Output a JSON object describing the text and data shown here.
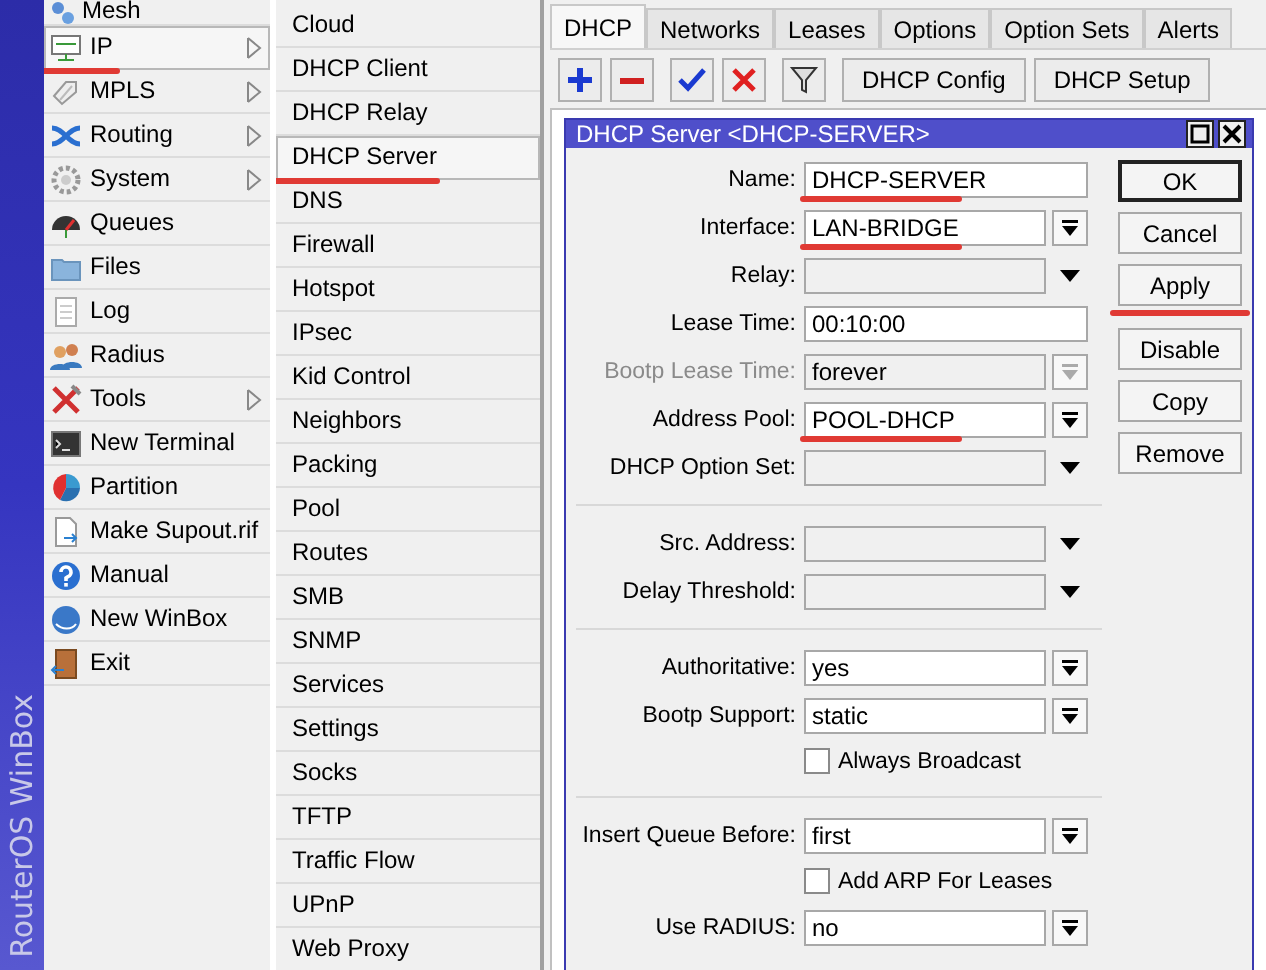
{
  "sidebar": {
    "brand": "RouterOS WinBox",
    "items": [
      {
        "label": "Mesh",
        "selected": false,
        "submenu": false,
        "underlined": false
      },
      {
        "label": "IP",
        "selected": true,
        "submenu": true,
        "underlined": true
      },
      {
        "label": "MPLS",
        "selected": false,
        "submenu": true,
        "underlined": false
      },
      {
        "label": "Routing",
        "selected": false,
        "submenu": true,
        "underlined": false
      },
      {
        "label": "System",
        "selected": false,
        "submenu": true,
        "underlined": false
      },
      {
        "label": "Queues",
        "selected": false,
        "submenu": false,
        "underlined": false
      },
      {
        "label": "Files",
        "selected": false,
        "submenu": false,
        "underlined": false
      },
      {
        "label": "Log",
        "selected": false,
        "submenu": false,
        "underlined": false
      },
      {
        "label": "Radius",
        "selected": false,
        "submenu": false,
        "underlined": false
      },
      {
        "label": "Tools",
        "selected": false,
        "submenu": true,
        "underlined": false
      },
      {
        "label": "New Terminal",
        "selected": false,
        "submenu": false,
        "underlined": false
      },
      {
        "label": "Partition",
        "selected": false,
        "submenu": false,
        "underlined": false
      },
      {
        "label": "Make Supout.rif",
        "selected": false,
        "submenu": false,
        "underlined": false
      },
      {
        "label": "Manual",
        "selected": false,
        "submenu": false,
        "underlined": false
      },
      {
        "label": "New WinBox",
        "selected": false,
        "submenu": false,
        "underlined": false
      },
      {
        "label": "Exit",
        "selected": false,
        "submenu": false,
        "underlined": false
      }
    ]
  },
  "submenu": {
    "items": [
      {
        "label": "Cloud",
        "selected": false,
        "underlined": false
      },
      {
        "label": "DHCP Client",
        "selected": false,
        "underlined": false
      },
      {
        "label": "DHCP Relay",
        "selected": false,
        "underlined": false
      },
      {
        "label": "DHCP Server",
        "selected": true,
        "underlined": true
      },
      {
        "label": "DNS",
        "selected": false,
        "underlined": false
      },
      {
        "label": "Firewall",
        "selected": false,
        "underlined": false
      },
      {
        "label": "Hotspot",
        "selected": false,
        "underlined": false
      },
      {
        "label": "IPsec",
        "selected": false,
        "underlined": false
      },
      {
        "label": "Kid Control",
        "selected": false,
        "underlined": false
      },
      {
        "label": "Neighbors",
        "selected": false,
        "underlined": false
      },
      {
        "label": "Packing",
        "selected": false,
        "underlined": false
      },
      {
        "label": "Pool",
        "selected": false,
        "underlined": false
      },
      {
        "label": "Routes",
        "selected": false,
        "underlined": false
      },
      {
        "label": "SMB",
        "selected": false,
        "underlined": false
      },
      {
        "label": "SNMP",
        "selected": false,
        "underlined": false
      },
      {
        "label": "Services",
        "selected": false,
        "underlined": false
      },
      {
        "label": "Settings",
        "selected": false,
        "underlined": false
      },
      {
        "label": "Socks",
        "selected": false,
        "underlined": false
      },
      {
        "label": "TFTP",
        "selected": false,
        "underlined": false
      },
      {
        "label": "Traffic Flow",
        "selected": false,
        "underlined": false
      },
      {
        "label": "UPnP",
        "selected": false,
        "underlined": false
      },
      {
        "label": "Web Proxy",
        "selected": false,
        "underlined": false
      }
    ]
  },
  "tabs": [
    {
      "label": "DHCP",
      "selected": true
    },
    {
      "label": "Networks",
      "selected": false
    },
    {
      "label": "Leases",
      "selected": false
    },
    {
      "label": "Options",
      "selected": false
    },
    {
      "label": "Option Sets",
      "selected": false
    },
    {
      "label": "Alerts",
      "selected": false
    }
  ],
  "toolbar": {
    "buttons": [
      "DHCP Config",
      "DHCP Setup"
    ]
  },
  "dialog": {
    "title": "DHCP Server <DHCP-SERVER>",
    "sections": [
      [
        {
          "kind": "text",
          "label": "Name:",
          "value": "DHCP-SERVER",
          "disabled": false,
          "underlined": true
        },
        {
          "kind": "select",
          "label": "Interface:",
          "value": "LAN-BRIDGE",
          "disabled": false,
          "underlined": true
        },
        {
          "kind": "combo",
          "label": "Relay:",
          "disabled": false,
          "underlined": false
        },
        {
          "kind": "text",
          "label": "Lease Time:",
          "value": "00:10:00",
          "disabled": false,
          "underlined": false
        },
        {
          "kind": "select",
          "label": "Bootp Lease Time:",
          "value": "forever",
          "disabled": true,
          "underlined": false
        },
        {
          "kind": "select",
          "label": "Address Pool:",
          "value": "POOL-DHCP",
          "disabled": false,
          "underlined": true
        },
        {
          "kind": "combo",
          "label": "DHCP Option Set:",
          "disabled": false,
          "underlined": false
        }
      ],
      [
        {
          "kind": "combo",
          "label": "Src. Address:",
          "disabled": false,
          "underlined": false
        },
        {
          "kind": "combo",
          "label": "Delay Threshold:",
          "disabled": false,
          "underlined": false
        }
      ],
      [
        {
          "kind": "select",
          "label": "Authoritative:",
          "value": "yes",
          "disabled": false,
          "underlined": false
        },
        {
          "kind": "select",
          "label": "Bootp Support:",
          "value": "static",
          "disabled": false,
          "underlined": false
        },
        {
          "kind": "checkbox",
          "label": "Always Broadcast",
          "checked": false,
          "disabled": false
        }
      ],
      [
        {
          "kind": "select",
          "label": "Insert Queue Before:",
          "value": "first",
          "disabled": false,
          "underlined": false
        },
        {
          "kind": "checkbox",
          "label": "Add ARP For Leases",
          "checked": false,
          "disabled": false
        },
        {
          "kind": "select",
          "label": "Use RADIUS:",
          "value": "no",
          "disabled": false,
          "underlined": false
        }
      ]
    ],
    "buttons": [
      {
        "label": "OK",
        "default": true,
        "underlined": false
      },
      {
        "label": "Cancel",
        "default": false,
        "underlined": false
      },
      {
        "label": "Apply",
        "default": false,
        "underlined": true
      },
      {
        "label": "Disable",
        "default": false,
        "underlined": false
      },
      {
        "label": "Copy",
        "default": false,
        "underlined": false
      },
      {
        "label": "Remove",
        "default": false,
        "underlined": false
      }
    ]
  }
}
